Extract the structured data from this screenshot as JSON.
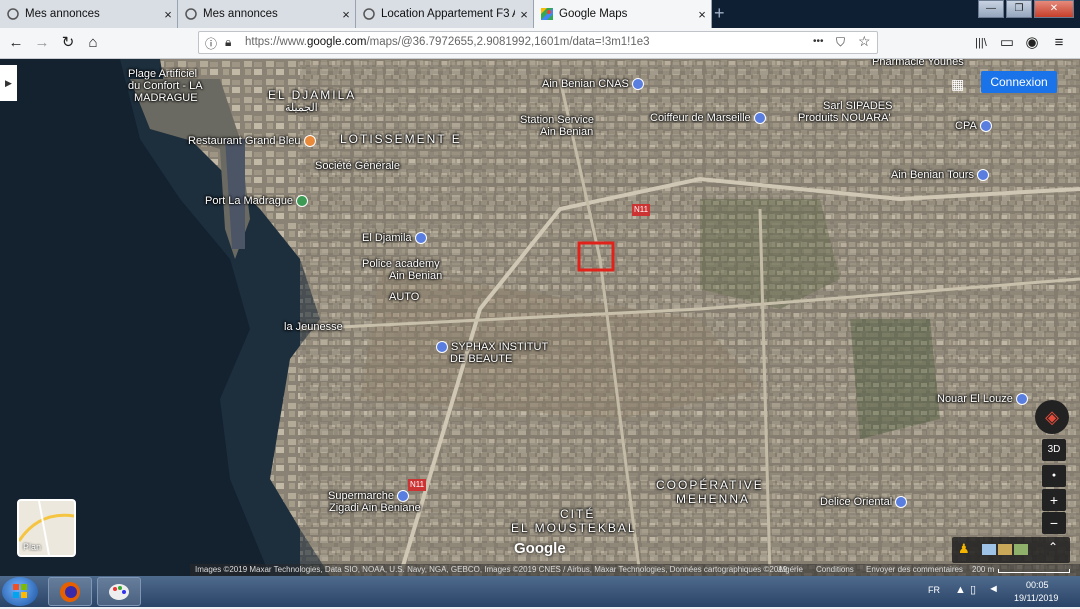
{
  "tabs": [
    {
      "title": "Mes annonces",
      "close": "×"
    },
    {
      "title": "Mes annonces",
      "close": "×"
    },
    {
      "title": "Location Appartement F3 Alge",
      "close": "×"
    },
    {
      "title": "Google Maps",
      "close": "×"
    }
  ],
  "new_tab": "+",
  "window_controls": {
    "minimize": "—",
    "maximize": "❐",
    "close": "✕"
  },
  "nav": {
    "back": "←",
    "forward": "→",
    "reload": "↻",
    "home": "⌂",
    "url_prefix": "https://www.",
    "url_host": "google.com",
    "url_rest": "/maps/@36.7972655,2.9081992,1601m/data=!3m1!1e3",
    "more": "•••",
    "pocket": "⛉",
    "bookmark": "☆",
    "library": "|||\\",
    "sidebar": "▭",
    "account": "◉",
    "menu": "≡"
  },
  "map": {
    "connexion": "Connexion",
    "apps_icon": "grid-icon",
    "labels": [
      "Plage Artificiel",
      "du Confort - LA",
      "MADRAGUE",
      "EL DJAMILA",
      "الجميلة",
      "LOTISSEMENT E",
      "Ain Benian CNAS",
      "Station Service",
      "Ain Benian",
      "Coiffeur de Marseille",
      "Sarl SIPADES",
      "Produits NOUARA'",
      "Pharmacie Younes",
      "CPA",
      "Restaurant Grand Bleu",
      "Société Générale",
      "Ain Benian Tours",
      "Port La Madrague",
      "N11",
      "El Djamila",
      "Police academy",
      "Ain Benian",
      "AUTO",
      "la Jeunesse",
      "SYPHAX INSTITUT",
      "DE BEAUTE",
      "Nouar El Louze",
      "COOPÉRATIVE",
      "MEHENNA",
      "CITÉ",
      "EL MOUSTEKBAL",
      "Supermarche",
      "Zigadi Ain Beniane",
      "Delice Oriental",
      "N11"
    ],
    "plan_label": "Plan",
    "google_logo": "Google",
    "controls": {
      "rotate": "◈",
      "tilt": "3D",
      "locate": "●",
      "zoom_in": "+",
      "zoom_out": "−",
      "expand": "⌃"
    },
    "footer": {
      "attribution": "Images ©2019 Maxar Technologies, Data SIO, NOAA, U.S. Navy, NGA, GEBCO, Images ©2019 CNES / Airbus, Maxar Technologies, Données cartographiques ©2019",
      "country": "Algérie",
      "conditions": "Conditions",
      "feedback": "Envoyer des commentaires",
      "scale": "200 m"
    }
  },
  "taskbar": {
    "language": "FR",
    "time": "00:05",
    "date": "19/11/2019"
  }
}
